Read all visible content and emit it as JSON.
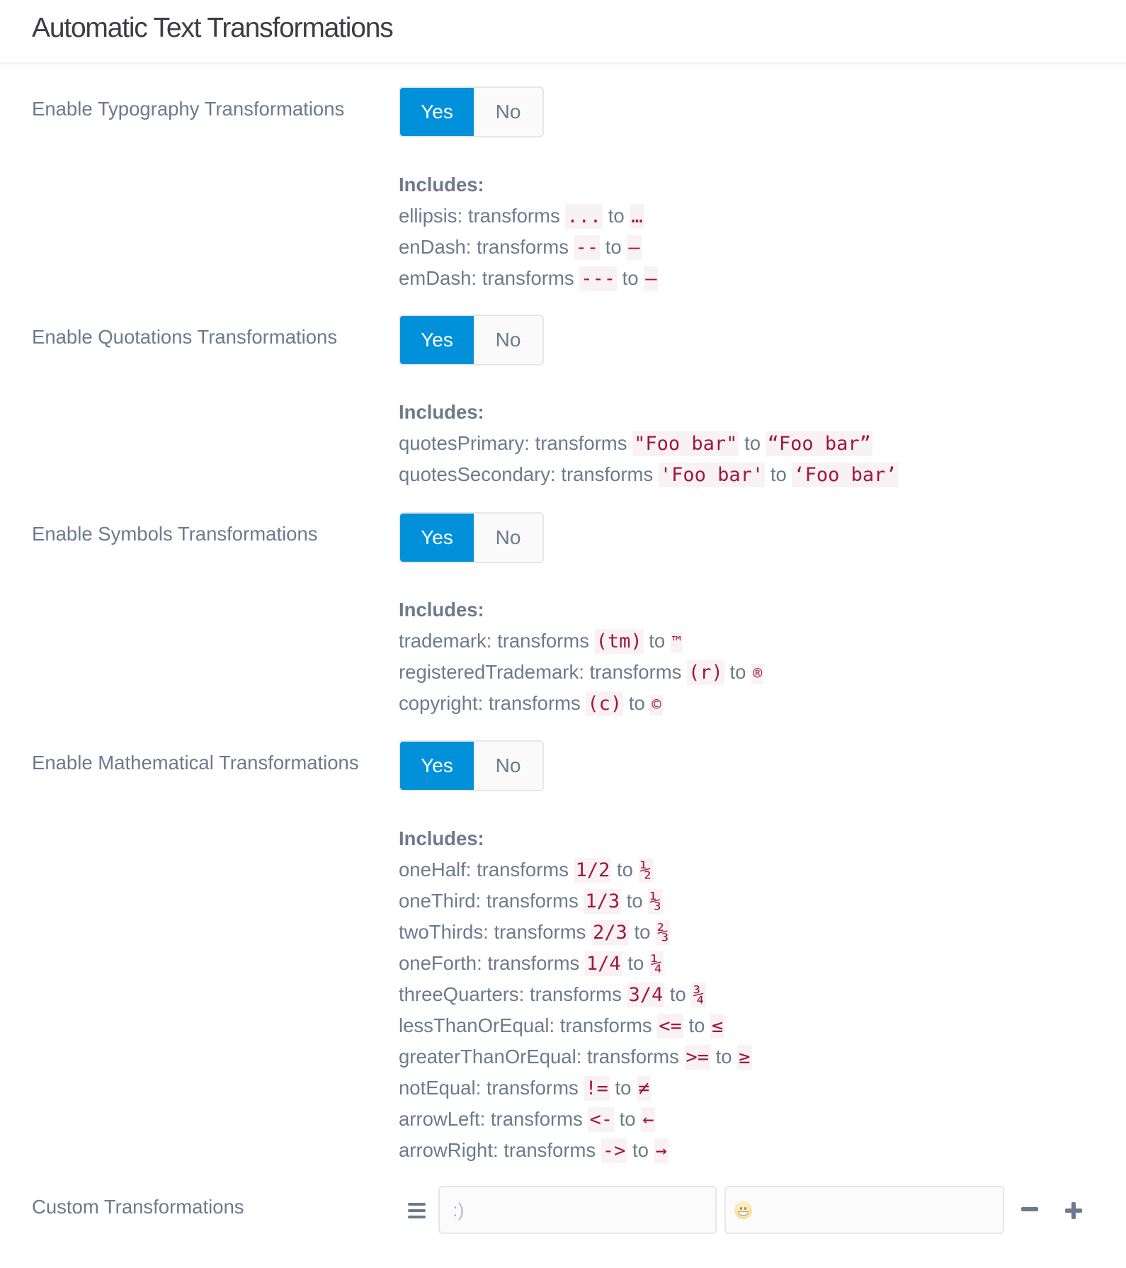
{
  "page": {
    "title": "Automatic Text Transformations"
  },
  "colors": {
    "accent": "#0091da",
    "code_text": "#a0173f",
    "code_bg": "#f9f2f4",
    "label": "#6e7a8c"
  },
  "common": {
    "transforms_word": "transforms",
    "to_word": "to",
    "includes_label": "Includes:"
  },
  "sections": [
    {
      "label": "Enable Typography Transformations",
      "yes_label": "Yes",
      "no_label": "No",
      "selected": "Yes",
      "items": [
        {
          "name": "ellipsis:",
          "from": "...",
          "to": "…"
        },
        {
          "name": "enDash:",
          "from": "--",
          "to": "–"
        },
        {
          "name": "emDash:",
          "from": "---",
          "to": "—"
        }
      ]
    },
    {
      "label": "Enable Quotations Transformations",
      "yes_label": "Yes",
      "no_label": "No",
      "selected": "Yes",
      "items": [
        {
          "name": "quotesPrimary:",
          "from": "\"Foo bar\"",
          "to": "“Foo bar”"
        },
        {
          "name": "quotesSecondary:",
          "from": "'Foo bar'",
          "to": "‘Foo bar’"
        }
      ]
    },
    {
      "label": "Enable Symbols Transformations",
      "yes_label": "Yes",
      "no_label": "No",
      "selected": "Yes",
      "items": [
        {
          "name": "trademark:",
          "from": "(tm)",
          "to": "™"
        },
        {
          "name": "registeredTrademark:",
          "from": "(r)",
          "to": "®"
        },
        {
          "name": "copyright:",
          "from": "(c)",
          "to": "©"
        }
      ]
    },
    {
      "label": "Enable Mathematical Transformations",
      "yes_label": "Yes",
      "no_label": "No",
      "selected": "Yes",
      "items": [
        {
          "name": "oneHalf:",
          "from": "1/2",
          "to": "½"
        },
        {
          "name": "oneThird:",
          "from": "1/3",
          "to": "⅓"
        },
        {
          "name": "twoThirds:",
          "from": "2/3",
          "to": "⅔"
        },
        {
          "name": "oneForth:",
          "from": "1/4",
          "to": "¼"
        },
        {
          "name": "threeQuarters:",
          "from": "3/4",
          "to": "¾"
        },
        {
          "name": "lessThanOrEqual:",
          "from": "<=",
          "to": "≤"
        },
        {
          "name": "greaterThanOrEqual:",
          "from": ">=",
          "to": "≥"
        },
        {
          "name": "notEqual:",
          "from": "!=",
          "to": "≠"
        },
        {
          "name": "arrowLeft:",
          "from": "<-",
          "to": "←"
        },
        {
          "name": "arrowRight:",
          "from": "->",
          "to": "→"
        }
      ]
    }
  ],
  "custom": {
    "label": "Custom Transformations",
    "from_placeholder": ":)",
    "to_placeholder": "",
    "to_placeholder_icon": "grinning-face-emoji",
    "drag_icon": "drag-handle-icon",
    "remove_icon": "minus-icon",
    "add_icon": "plus-icon"
  }
}
